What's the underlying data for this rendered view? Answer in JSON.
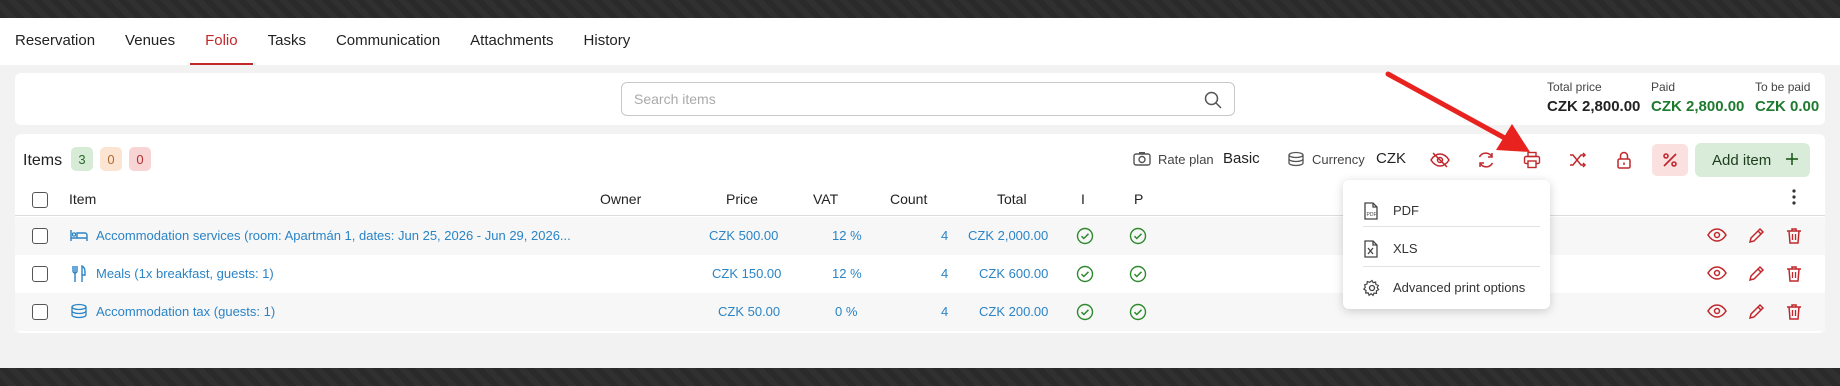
{
  "tabs": [
    "Reservation",
    "Venues",
    "Folio",
    "Tasks",
    "Communication",
    "Attachments",
    "History"
  ],
  "active_tab": "Folio",
  "search": {
    "placeholder": "Search items"
  },
  "totals": {
    "total_price": {
      "label": "Total price",
      "value": "CZK 2,800.00"
    },
    "paid": {
      "label": "Paid",
      "value": "CZK 2,800.00"
    },
    "to_be_paid": {
      "label": "To be paid",
      "value": "CZK 0.00"
    }
  },
  "items": {
    "title": "Items",
    "badges": [
      "3",
      "0",
      "0"
    ]
  },
  "toolbar": {
    "rate_plan_label": "Rate plan",
    "rate_plan_value": "Basic",
    "currency_label": "Currency",
    "currency_value": "CZK",
    "add_item": "Add item"
  },
  "columns": [
    "Item",
    "Owner",
    "Price",
    "VAT",
    "Count",
    "Total",
    "I",
    "P"
  ],
  "rows": [
    {
      "icon": "bed-icon",
      "item": "Accommodation services (room: Apartmán 1, dates: Jun 25, 2026 - Jun 29, 2026...",
      "owner": "",
      "price": "CZK 500.00",
      "vat": "12 %",
      "count": "4",
      "total": "CZK 2,000.00"
    },
    {
      "icon": "cutlery-icon",
      "item": "Meals (1x breakfast, guests: 1)",
      "owner": "",
      "price": "CZK 150.00",
      "vat": "12 %",
      "count": "4",
      "total": "CZK 600.00"
    },
    {
      "icon": "coins-icon",
      "item": "Accommodation tax (guests: 1)",
      "owner": "",
      "price": "CZK 50.00",
      "vat": "0 %",
      "count": "4",
      "total": "CZK 200.00"
    }
  ],
  "print_menu": {
    "items": [
      {
        "icon": "pdf-file-icon",
        "label": "PDF"
      },
      {
        "icon": "xls-file-icon",
        "label": "XLS"
      },
      {
        "icon": "gear-icon",
        "label": "Advanced print options"
      }
    ]
  },
  "colors": {
    "accent": "#c0282c",
    "link": "#2a84c6",
    "paid_green": "#1e7a2e",
    "add_button_bg": "#d9ecd9"
  }
}
